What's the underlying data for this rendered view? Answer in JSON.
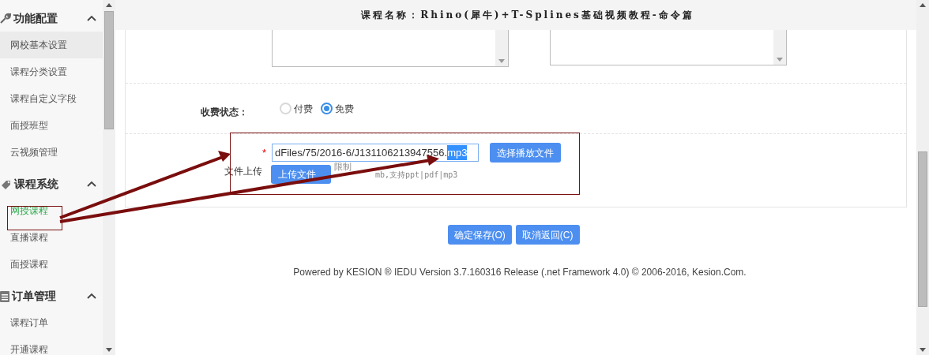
{
  "sidebar": {
    "sections": [
      {
        "title": "功能配置",
        "expanded": true,
        "items": [
          {
            "label": "网校基本设置",
            "selected": false,
            "highlighted": true
          },
          {
            "label": "课程分类设置",
            "selected": false,
            "highlighted": false
          },
          {
            "label": "课程自定义字段",
            "selected": false,
            "highlighted": false
          },
          {
            "label": "面授班型",
            "selected": false,
            "highlighted": false
          },
          {
            "label": "云视频管理",
            "selected": false,
            "highlighted": false
          }
        ]
      },
      {
        "title": "课程系统",
        "expanded": true,
        "items": [
          {
            "label": "网授课程",
            "selected": true,
            "highlighted": false
          },
          {
            "label": "直播课程",
            "selected": false,
            "highlighted": false
          },
          {
            "label": "面授课程",
            "selected": false,
            "highlighted": false
          }
        ]
      },
      {
        "title": "订单管理",
        "expanded": true,
        "items": [
          {
            "label": "课程订单",
            "selected": false,
            "highlighted": false
          },
          {
            "label": "开通课程",
            "selected": false,
            "highlighted": false
          }
        ]
      }
    ]
  },
  "header": {
    "title": "课程名称：Rhino(犀牛)+T-Splines基础视频教程-命令篇"
  },
  "form": {
    "fee_status": {
      "label": "收费状态：",
      "options": [
        {
          "label": "付费",
          "selected": false
        },
        {
          "label": "免费",
          "selected": true
        }
      ]
    },
    "upload": {
      "label": "文件上传",
      "required_mark": "*",
      "value_plain": "dFiles/75/2016-6/J131106213947556.",
      "value_selected": "mp3",
      "choose_button": "选择播放文件",
      "upload_button": "上传文件",
      "hint_start": "限制",
      "hint_end": "mb,支持ppt|pdf|mp3"
    }
  },
  "actions": [
    {
      "label": "确定保存(O)"
    },
    {
      "label": "取消返回(C)"
    }
  ],
  "footer": "Powered by KESION ® IEDU Version 3.7.160316 Release (.net Framework 4.0) © 2006-2016, Kesion.Com."
}
